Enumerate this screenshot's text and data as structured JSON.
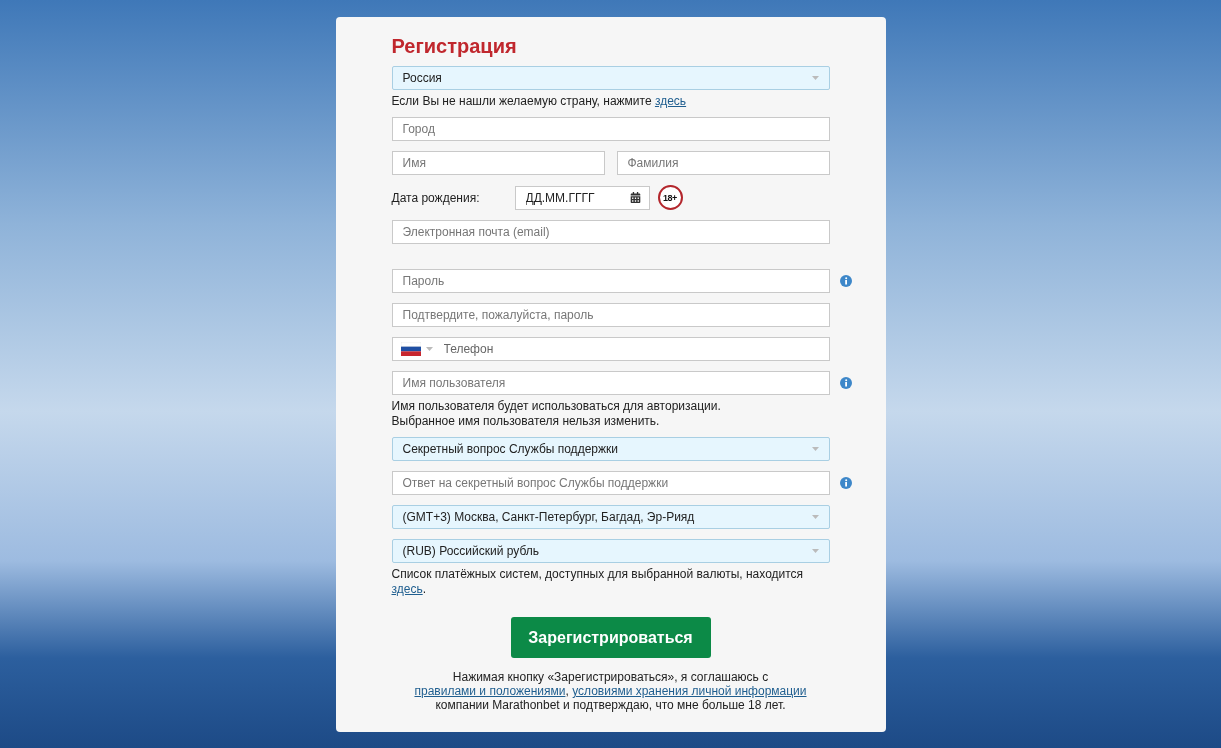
{
  "title": "Регистрация",
  "sections": [
    [
      {
        "kind": "select",
        "value": "Россия",
        "info": false
      },
      {
        "kind": "note",
        "parts": [
          {
            "text": "Если Вы не нашли желаемую страну, нажмите "
          },
          {
            "link": "здесь"
          }
        ]
      },
      {
        "kind": "text",
        "placeholder": "Город",
        "info": false
      },
      {
        "kind": "pair",
        "placeholders": [
          "Имя",
          "Фамилия"
        ]
      },
      {
        "kind": "date",
        "label": "Дата рождения:",
        "placeholder": "ДД.ММ.ГГГГ",
        "badge": "18+"
      },
      {
        "kind": "text",
        "placeholder": "Электронная почта (email)",
        "info": false
      }
    ],
    [
      {
        "kind": "text",
        "placeholder": "Пароль",
        "info": true
      },
      {
        "kind": "text",
        "placeholder": "Подтвердите, пожалуйста, пароль",
        "info": false
      },
      {
        "kind": "phone",
        "placeholder": "Телефон"
      },
      {
        "kind": "text",
        "placeholder": "Имя пользователя",
        "info": true
      },
      {
        "kind": "lines",
        "lines": [
          "Имя пользователя будет использоваться для авторизации.",
          "Выбранное имя пользователя нельзя изменить."
        ]
      },
      {
        "kind": "select",
        "value": "Секретный вопрос Службы поддержки",
        "info": false
      },
      {
        "kind": "text",
        "placeholder": "Ответ на секретный вопрос Службы поддержки",
        "info": true
      },
      {
        "kind": "select",
        "value": "(GMT+3) Москва, Санкт-Петербург, Багдад, Эр-Рияд",
        "info": false
      },
      {
        "kind": "select",
        "value": "(RUB) Российский рубль",
        "info": false
      },
      {
        "kind": "note",
        "parts": [
          {
            "text": "Список платёжных систем, доступных для выбранной валюты, находится "
          },
          {
            "link": "здесь"
          },
          {
            "text": "."
          }
        ]
      }
    ]
  ],
  "submit": "Зарегистрироваться",
  "agreement": [
    {
      "text": "Нажимая кнопку «Зарегистрироваться», я соглашаюсь с "
    },
    {
      "link": "правилами и положениями"
    },
    {
      "text": ", "
    },
    {
      "link": "условиями хранения личной информации"
    },
    {
      "text": " компании Marathonbet и подтверждаю, что мне больше 18 лет."
    }
  ]
}
